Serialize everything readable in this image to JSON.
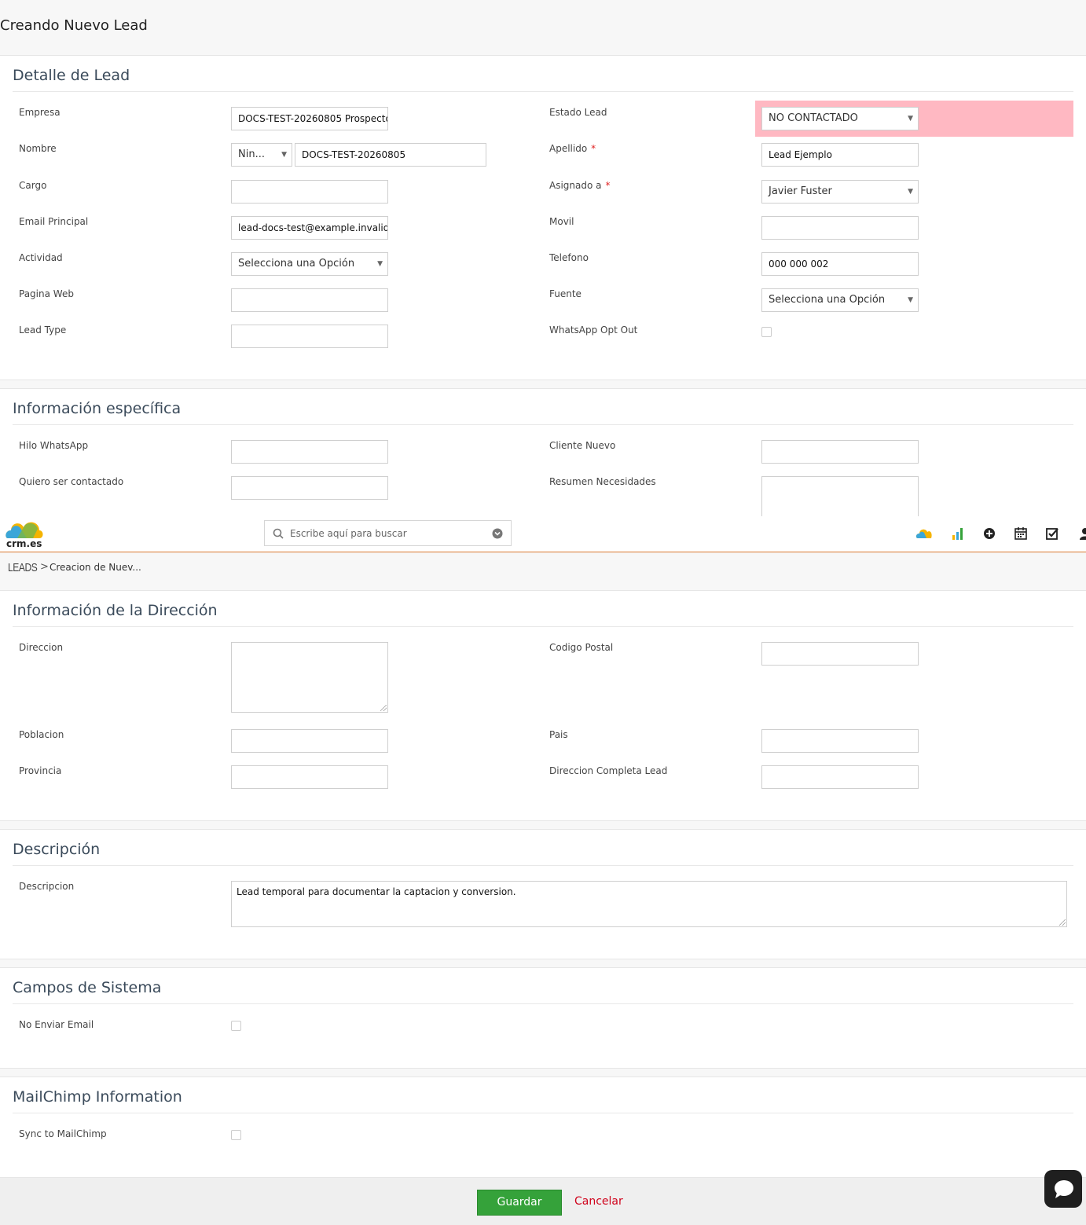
{
  "page": {
    "title": "Creando Nuevo Lead"
  },
  "topbar": {
    "logo_text": "crm.es",
    "search_placeholder": "Escribe aquí para buscar"
  },
  "breadcrumb": {
    "module": "LEADS",
    "separator": ">",
    "current": "Creacion de Nuev..."
  },
  "sections": {
    "detalle": {
      "title": "Detalle de Lead",
      "empresa": {
        "label": "Empresa",
        "value": "DOCS-TEST-20260805 Prospecto"
      },
      "nombre": {
        "label": "Nombre",
        "salutation": "Nin...",
        "value": "DOCS-TEST-20260805"
      },
      "cargo": {
        "label": "Cargo",
        "value": ""
      },
      "email": {
        "label": "Email Principal",
        "value": "lead-docs-test@example.invalid"
      },
      "actividad": {
        "label": "Actividad",
        "value": "Selecciona una Opción"
      },
      "web": {
        "label": "Pagina Web",
        "value": ""
      },
      "leadtype": {
        "label": "Lead Type",
        "value": ""
      },
      "estado": {
        "label": "Estado Lead",
        "value": "NO CONTACTADO",
        "highlight": "#ffb8c2"
      },
      "apellido": {
        "label": "Apellido",
        "required": "*",
        "value": "Lead Ejemplo"
      },
      "asignado": {
        "label": "Asignado a",
        "required": "*",
        "value": "Javier Fuster"
      },
      "movil": {
        "label": "Movil",
        "value": ""
      },
      "telefono": {
        "label": "Telefono",
        "value": "000 000 002"
      },
      "fuente": {
        "label": "Fuente",
        "value": "Selecciona una Opción"
      },
      "whatsapp_optout": {
        "label": "WhatsApp Opt Out",
        "checked": false
      }
    },
    "especifica": {
      "title": "Información específica",
      "hilo": {
        "label": "Hilo WhatsApp",
        "value": ""
      },
      "contactado": {
        "label": "Quiero ser contactado",
        "value": ""
      },
      "cliente_nuevo": {
        "label": "Cliente Nuevo",
        "value": ""
      },
      "resumen": {
        "label": "Resumen Necesidades",
        "value": ""
      }
    },
    "direccion": {
      "title": "Información de la Dirección",
      "direccion": {
        "label": "Direccion",
        "value": ""
      },
      "poblacion": {
        "label": "Poblacion",
        "value": ""
      },
      "provincia": {
        "label": "Provincia",
        "value": ""
      },
      "cp": {
        "label": "Codigo Postal",
        "value": ""
      },
      "pais": {
        "label": "Pais",
        "value": ""
      },
      "completa": {
        "label": "Direccion Completa Lead",
        "value": ""
      }
    },
    "descripcion": {
      "title": "Descripción",
      "descripcion": {
        "label": "Descripcion",
        "value": "Lead temporal para documentar la captacion y conversion."
      }
    },
    "sistema": {
      "title": "Campos de Sistema",
      "no_email": {
        "label": "No Enviar Email",
        "checked": false
      }
    },
    "mailchimp": {
      "title": "MailChimp Information",
      "sync": {
        "label": "Sync to MailChimp",
        "checked": false
      }
    }
  },
  "footer": {
    "save_label": "Guardar",
    "cancel_label": "Cancelar"
  },
  "colors": {
    "primary_button": "#35a23a",
    "cancel_link": "#d0021b",
    "topbar_border": "#d9772e"
  }
}
